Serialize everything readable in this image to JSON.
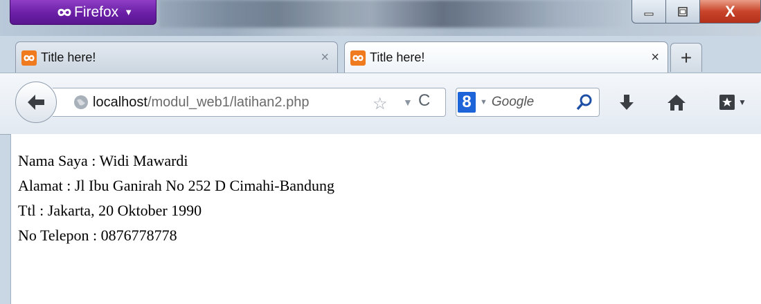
{
  "app": {
    "menu_button_label": "Firefox"
  },
  "window_controls": {
    "close_label": "X"
  },
  "tabs": [
    {
      "title": "Title here!",
      "active": false
    },
    {
      "title": "Title here!",
      "active": true
    }
  ],
  "tab_close_glyph": "×",
  "new_tab_glyph": "+",
  "address": {
    "host": "localhost",
    "path": "/modul_web1/latihan2.php"
  },
  "search": {
    "engine_letter": "8",
    "placeholder": "Google"
  },
  "page": {
    "lines": [
      "Nama Saya : Widi Mawardi",
      "Alamat : Jl Ibu Ganirah No 252 D Cimahi-Bandung",
      "Ttl : Jakarta, 20 Oktober 1990",
      "No Telepon : 0876778778"
    ]
  },
  "colors": {
    "firefox_purple": "#6a1fa6",
    "close_red": "#c8442a",
    "tab_icon_orange": "#f07a1e"
  }
}
